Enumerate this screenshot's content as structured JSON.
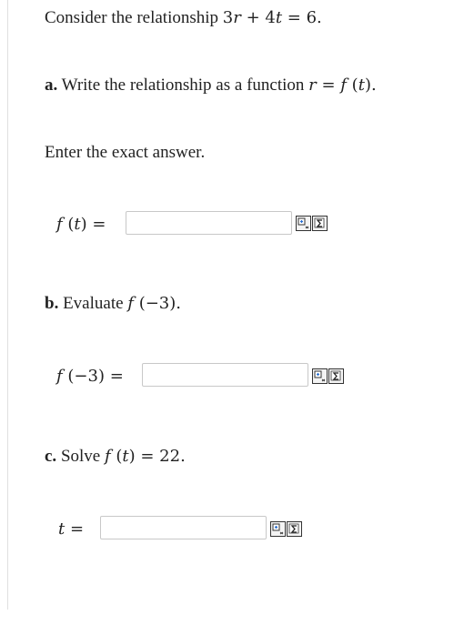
{
  "intro": {
    "prefix": "Consider the relationship ",
    "equation_left": "3",
    "var_r": "r",
    "plus": " + 4",
    "var_t": "t",
    "equals": " = 6."
  },
  "part_a": {
    "letter": "a.",
    "text": " Write the relationship as a function ",
    "r": "r",
    "eq": " = ",
    "f": "f",
    "arg_open": " (",
    "t": "t",
    "arg_close": ").",
    "instruction": "Enter the exact answer.",
    "label_f": "f",
    "label_arg": " (",
    "label_t": "t",
    "label_close": ") =",
    "input_value": "",
    "input_placeholder": ""
  },
  "part_b": {
    "letter": "b.",
    "text": " Evaluate ",
    "f": "f",
    "arg": " (−3).",
    "label_f": "f",
    "label_arg": " (−3) =",
    "input_value": "",
    "input_placeholder": ""
  },
  "part_c": {
    "letter": "c.",
    "text": " Solve ",
    "f": "f",
    "arg_open": " (",
    "t": "t",
    "arg_close": ") = 22.",
    "label_t": "t",
    "label_eq": " =",
    "input_value": "",
    "input_placeholder": ""
  },
  "tools": {
    "equation_editor_icon": "equation-editor-icon",
    "sum_icon": "sum-symbol-icon"
  }
}
